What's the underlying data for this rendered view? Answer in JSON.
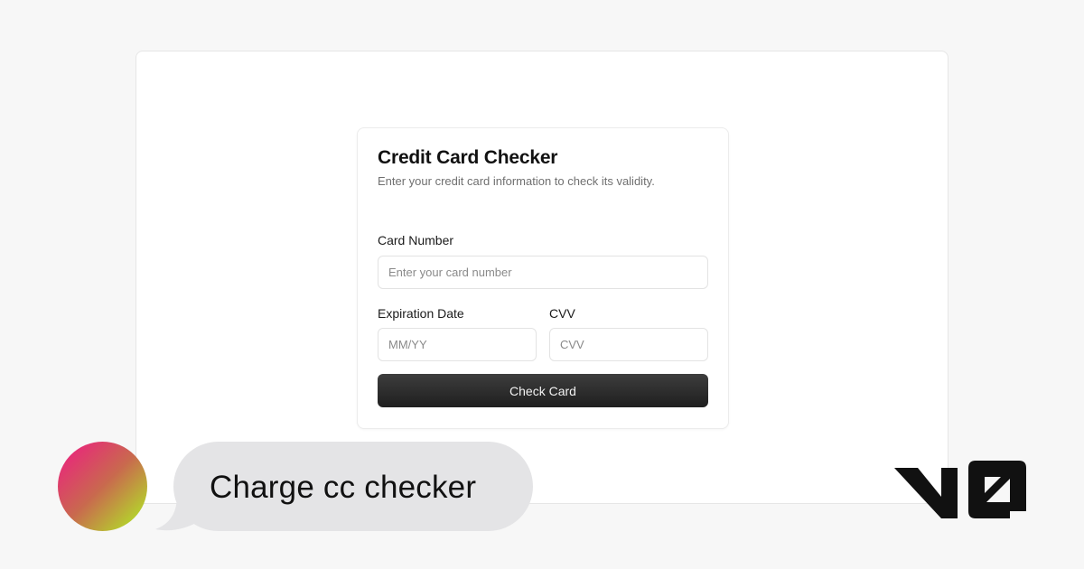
{
  "form": {
    "title": "Credit Card Checker",
    "subtitle": "Enter your credit card information to check its validity.",
    "card_number": {
      "label": "Card Number",
      "placeholder": "Enter your card number",
      "value": ""
    },
    "expiration": {
      "label": "Expiration Date",
      "placeholder": "MM/YY",
      "value": ""
    },
    "cvv": {
      "label": "CVV",
      "placeholder": "CVV",
      "value": ""
    },
    "submit_label": "Check Card"
  },
  "chat": {
    "prompt_text": "Charge cc checker"
  },
  "brand": {
    "logo_icon": "v0-logo-icon",
    "logo_text": "v0",
    "button_color": "#2a2a2a",
    "bubble_color": "#e4e4e6",
    "avatar_gradient": [
      "#e8287a",
      "#b3d92a"
    ]
  }
}
